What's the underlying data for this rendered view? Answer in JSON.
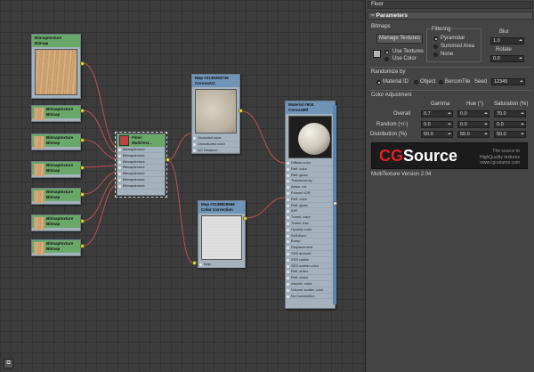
{
  "window": {
    "title": "Floor"
  },
  "rollout": {
    "label": "Parameters"
  },
  "bitmaps": {
    "label": "Bitmaps",
    "manage_button": "Manage Textures",
    "use_textures": "Use Textures",
    "use_color": "Use Color"
  },
  "filtering": {
    "label": "Filtering",
    "options": [
      "Pyramidal",
      "Summed Area",
      "None"
    ],
    "selected": "Pyramidal"
  },
  "blur": {
    "label": "Blur",
    "value": "1.0"
  },
  "rotate": {
    "label": "Rotate",
    "value": "0.0"
  },
  "randomize": {
    "label": "Randomize by",
    "options": [
      "Material ID",
      "Object",
      "BerconTile"
    ],
    "selected": "Material ID",
    "seed_label": "Seed",
    "seed_value": "12345"
  },
  "color_adjustment": {
    "label": "Color Adjustment",
    "columns": [
      "Gamma",
      "Hue (°)",
      "Saturation (%)"
    ],
    "rows": [
      {
        "label": "Overall",
        "values": [
          "0.7",
          "0.0",
          "70.0"
        ]
      },
      {
        "label": "Random (+/-)",
        "values": [
          "0.0",
          "0.0",
          "0.0"
        ]
      },
      {
        "label": "Distribution (%)",
        "values": [
          "50.0",
          "50.0",
          "50.0"
        ]
      }
    ]
  },
  "logo": {
    "cg": "CG",
    "source": "Source",
    "tagline_1": "The source to",
    "tagline_2": "HighQuality textures",
    "tagline_3": "www.cg-source.com"
  },
  "version": "MultiTexture Version 2.04",
  "nodes": {
    "bitmap": {
      "line1": "Bitmaptexture",
      "line2": "Bitmap"
    },
    "multitex": {
      "line1": "Floor",
      "line2": "MultiText...",
      "ports": [
        "Bitmaptexture",
        "Bitmaptexture",
        "Bitmaptexture",
        "Bitmaptexture",
        "Bitmaptexture",
        "Bitmaptexture",
        "Bitmaptexture"
      ]
    },
    "coronaao": {
      "line1": "Map #2138383736",
      "line2": "CoronaAO",
      "ports": [
        "Occluded color",
        "Unoccluded color",
        "AO Distance"
      ]
    },
    "colorcorrection": {
      "line1": "Map #2138828666",
      "line2": "Color Correction",
      "ports": [
        "Map"
      ]
    },
    "material": {
      "line1": "Material #604",
      "line2": "CoronaMtl",
      "ports": [
        "Diffuse color",
        "Refl. color",
        "Refl. gloss",
        "Translucency",
        "Aniso. rot.",
        "Fresnel IOR",
        "Refl. color",
        "Refl. gloss",
        "IOR",
        "Transl. color",
        "Transl. frac.",
        "Opacity color",
        "Self-Illum.",
        "Bump",
        "Displacement",
        "SSS amount",
        "SSS radius",
        "SSS scatter color",
        "Refl. aniso.",
        "Refl. aniso.",
        "Absorb. color",
        "Volume scatter color",
        "No Connection"
      ]
    }
  },
  "colors": {
    "accent_red": "#e02222",
    "node_header_green": "#6aa86a",
    "node_header_blue": "#6f94b8",
    "wire": "#c0504d"
  }
}
